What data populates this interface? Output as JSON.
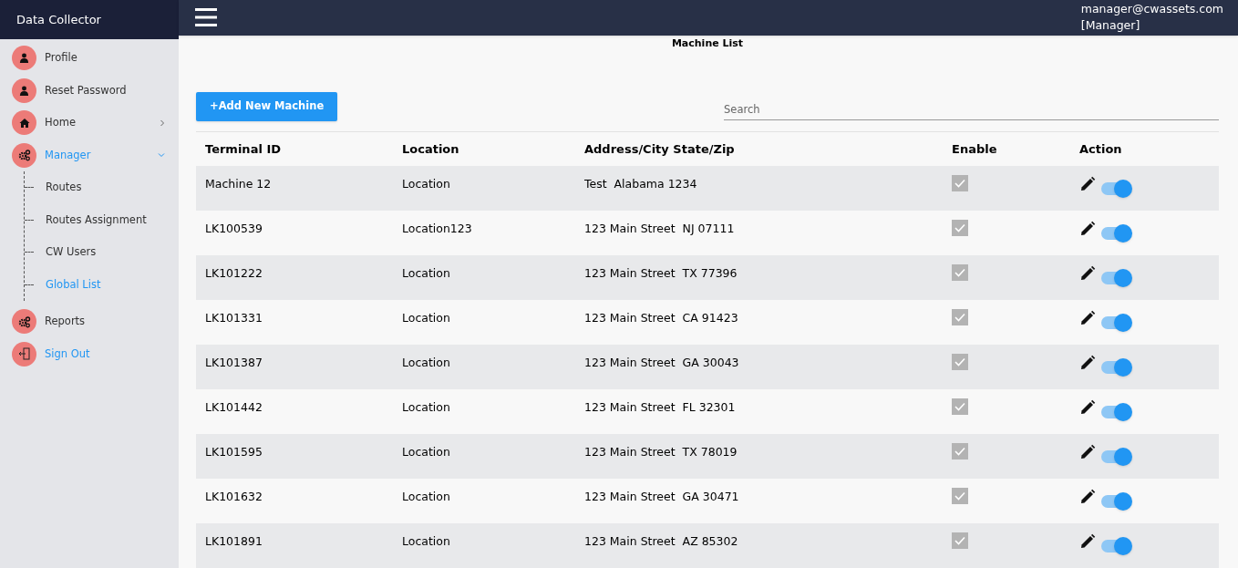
{
  "app": {
    "title": "Data Collector"
  },
  "user": {
    "email": "manager@cwassets.com",
    "role": "[Manager]"
  },
  "sidebar": {
    "items": [
      {
        "label": "Profile",
        "highlighted": false
      },
      {
        "label": "Reset Password",
        "highlighted": false
      },
      {
        "label": "Home",
        "highlighted": false,
        "expanded": false
      },
      {
        "label": "Manager",
        "highlighted": true,
        "expanded": true,
        "children": [
          {
            "label": "Routes",
            "highlighted": false
          },
          {
            "label": "Routes Assignment",
            "highlighted": false
          },
          {
            "label": "CW Users",
            "highlighted": false
          },
          {
            "label": "Global List",
            "highlighted": true
          }
        ]
      },
      {
        "label": "Reports",
        "highlighted": false
      },
      {
        "label": "Sign Out",
        "highlighted": true
      }
    ]
  },
  "page": {
    "title": "Machine List",
    "add_button": "+Add New Machine",
    "search": {
      "placeholder": "Search"
    }
  },
  "table": {
    "columns": [
      "Terminal ID",
      "Location",
      "Address/City State/Zip",
      "Enable",
      "Action"
    ],
    "rows": [
      {
        "terminal_id": "Machine 12",
        "location": "Location",
        "address": "Test  Alabama 1234",
        "enabled": true,
        "on": true
      },
      {
        "terminal_id": "LK100539",
        "location": "Location123",
        "address": "123 Main Street  NJ 07111",
        "enabled": true,
        "on": true
      },
      {
        "terminal_id": "LK101222",
        "location": "Location",
        "address": "123 Main Street  TX 77396",
        "enabled": true,
        "on": true
      },
      {
        "terminal_id": "LK101331",
        "location": "Location",
        "address": "123 Main Street  CA 91423",
        "enabled": true,
        "on": true
      },
      {
        "terminal_id": "LK101387",
        "location": "Location",
        "address": "123 Main Street  GA 30043",
        "enabled": true,
        "on": true
      },
      {
        "terminal_id": "LK101442",
        "location": "Location",
        "address": "123 Main Street  FL 32301",
        "enabled": true,
        "on": true
      },
      {
        "terminal_id": "LK101595",
        "location": "Location",
        "address": "123 Main Street  TX 78019",
        "enabled": true,
        "on": true
      },
      {
        "terminal_id": "LK101632",
        "location": "Location",
        "address": "123 Main Street  GA 30471",
        "enabled": true,
        "on": true
      },
      {
        "terminal_id": "LK101891",
        "location": "Location",
        "address": "123 Main Street  AZ 85302",
        "enabled": true,
        "on": true
      }
    ]
  }
}
